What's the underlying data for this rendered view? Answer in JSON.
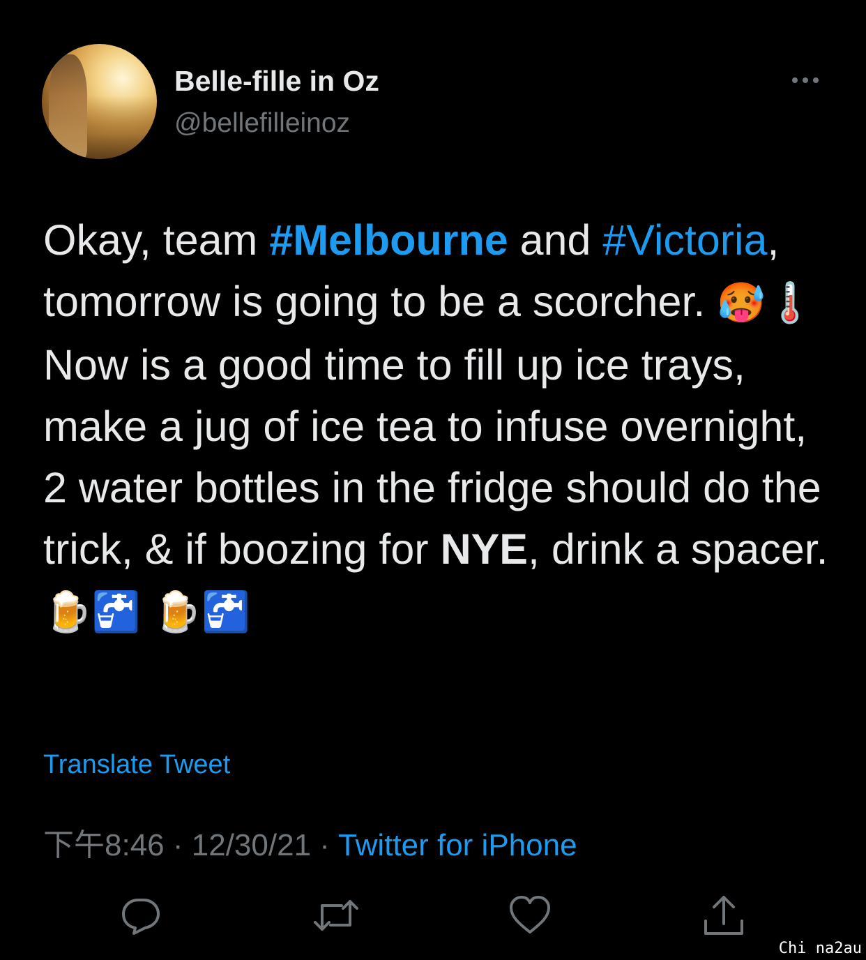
{
  "author": {
    "display_name": "Belle-fille in Oz",
    "handle": "@bellefilleinoz"
  },
  "tweet": {
    "segments": [
      {
        "text": "Okay, team ",
        "style": "text"
      },
      {
        "text": "#Melbourne",
        "style": "hashtag-bold"
      },
      {
        "text": " and ",
        "style": "text"
      },
      {
        "text": "#Victoria",
        "style": "hashtag"
      },
      {
        "text": ", tomorrow is going to be a scorcher. ",
        "style": "text"
      },
      {
        "text": "🥵🌡️",
        "style": "emoji"
      },
      {
        "text": " Now is a good time to fill up ice trays, make a jug of ice tea to infuse overnight, 2 water bottles in the fridge should do the trick, & if boozing for ",
        "style": "text"
      },
      {
        "text": "NYE",
        "style": "bold"
      },
      {
        "text": ", drink a spacer. ",
        "style": "text"
      },
      {
        "text": "🍺🚰 🍺🚰",
        "style": "emoji"
      }
    ]
  },
  "translate_label": "Translate Tweet",
  "meta": {
    "time": "下午8:46",
    "separator": "·",
    "date": "12/30/21",
    "source": "Twitter for iPhone"
  },
  "actions": {
    "reply_icon": "reply-icon",
    "retweet_icon": "retweet-icon",
    "like_icon": "heart-icon",
    "share_icon": "share-icon"
  },
  "watermark": "Chi na2au",
  "colors": {
    "background": "#000000",
    "text": "#e7e9ea",
    "secondary": "#71767b",
    "accent": "#1d9bf0"
  }
}
